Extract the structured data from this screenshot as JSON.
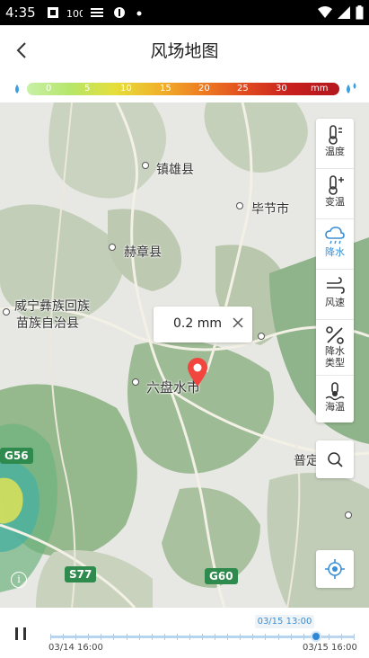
{
  "status_bar": {
    "time": "4:35"
  },
  "header": {
    "title": "风场地图"
  },
  "legend": {
    "ticks": [
      "0",
      "5",
      "10",
      "15",
      "20",
      "25",
      "30"
    ],
    "unit": "mm"
  },
  "map": {
    "cities": [
      {
        "name": "镇雄县"
      },
      {
        "name": "毕节市"
      },
      {
        "name": "赫章县"
      },
      {
        "name": "威宁彝族回族"
      },
      {
        "name": "苗族自治县"
      },
      {
        "name": "六盘水市"
      },
      {
        "name": "普定"
      }
    ],
    "roads": [
      "G56",
      "S77",
      "G60"
    ],
    "popup": {
      "value": "0.2 mm"
    }
  },
  "toolbar": {
    "items": [
      {
        "label": "温度",
        "icon": "thermometer-icon",
        "active": false
      },
      {
        "label": "变温",
        "icon": "thermometer-plus-icon",
        "active": false
      },
      {
        "label": "降水",
        "icon": "rain-cloud-icon",
        "active": true
      },
      {
        "label": "风速",
        "icon": "wind-icon",
        "active": false
      },
      {
        "label": "降水\n类型",
        "icon": "precip-type-icon",
        "active": false
      },
      {
        "label": "海温",
        "icon": "sea-temp-icon",
        "active": false
      }
    ]
  },
  "timeline": {
    "current_label": "03/15 13:00",
    "start_label": "03/14 16:00",
    "end_label": "03/15 16:00",
    "progress": 0.875
  },
  "colors": {
    "accent": "#3b8fd6",
    "marker": "#f2453d",
    "road": "#2f8a4e"
  }
}
